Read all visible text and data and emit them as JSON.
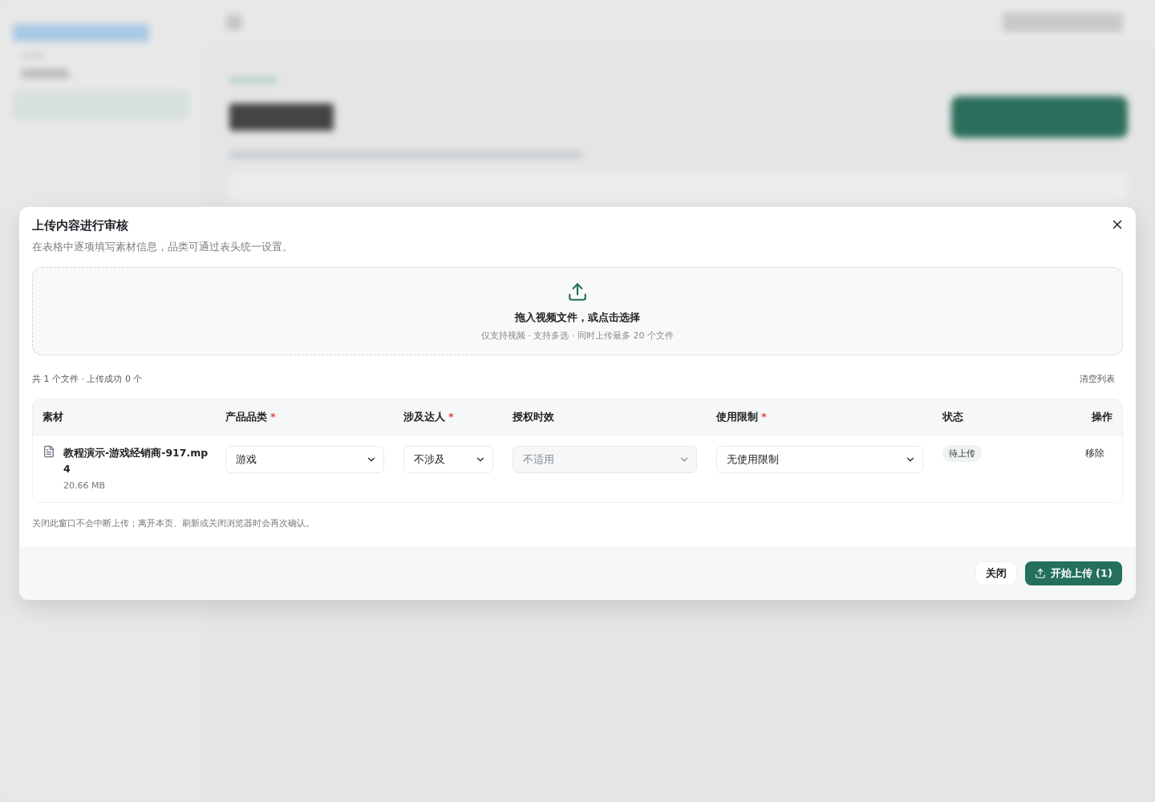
{
  "dialog": {
    "title": "上传内容进行审核",
    "subtitle": "在表格中逐项填写素材信息，品类可通过表头统一设置。",
    "dropzone": {
      "title": "拖入视频文件，或点击选择",
      "hint": "仅支持视频 · 支持多选 · 同时上传最多 20 个文件"
    },
    "summary": "共 1 个文件 · 上传成功 0 个",
    "clear_link": "清空列表",
    "table": {
      "columns": [
        {
          "label": "素材"
        },
        {
          "label": "产品品类",
          "required_mark": "*"
        },
        {
          "label": "涉及达人",
          "required_mark": "*"
        },
        {
          "label": "授权时效"
        },
        {
          "label": "使用限制",
          "required_mark": "*"
        },
        {
          "label": "状态"
        },
        {
          "label": "操作"
        }
      ],
      "rows": [
        {
          "file_name": "教程演示-游戏经销商-917.mp4",
          "file_size": "20.66 MB",
          "category": {
            "value": "游戏",
            "disabled": false
          },
          "influencer": {
            "value": "不涉及",
            "disabled": false
          },
          "authorization": {
            "value": "不适用",
            "disabled": true
          },
          "usage": {
            "value": "无使用限制",
            "disabled": false
          },
          "status": "待上传",
          "action": "移除"
        }
      ]
    },
    "note": "关闭此窗口不会中断上传；离开本页、刷新或关闭浏览器时会再次确认。",
    "buttons": [
      {
        "label": "关闭",
        "kind": "secondary"
      },
      {
        "label": "开始上传 (1)",
        "kind": "primary"
      }
    ]
  }
}
